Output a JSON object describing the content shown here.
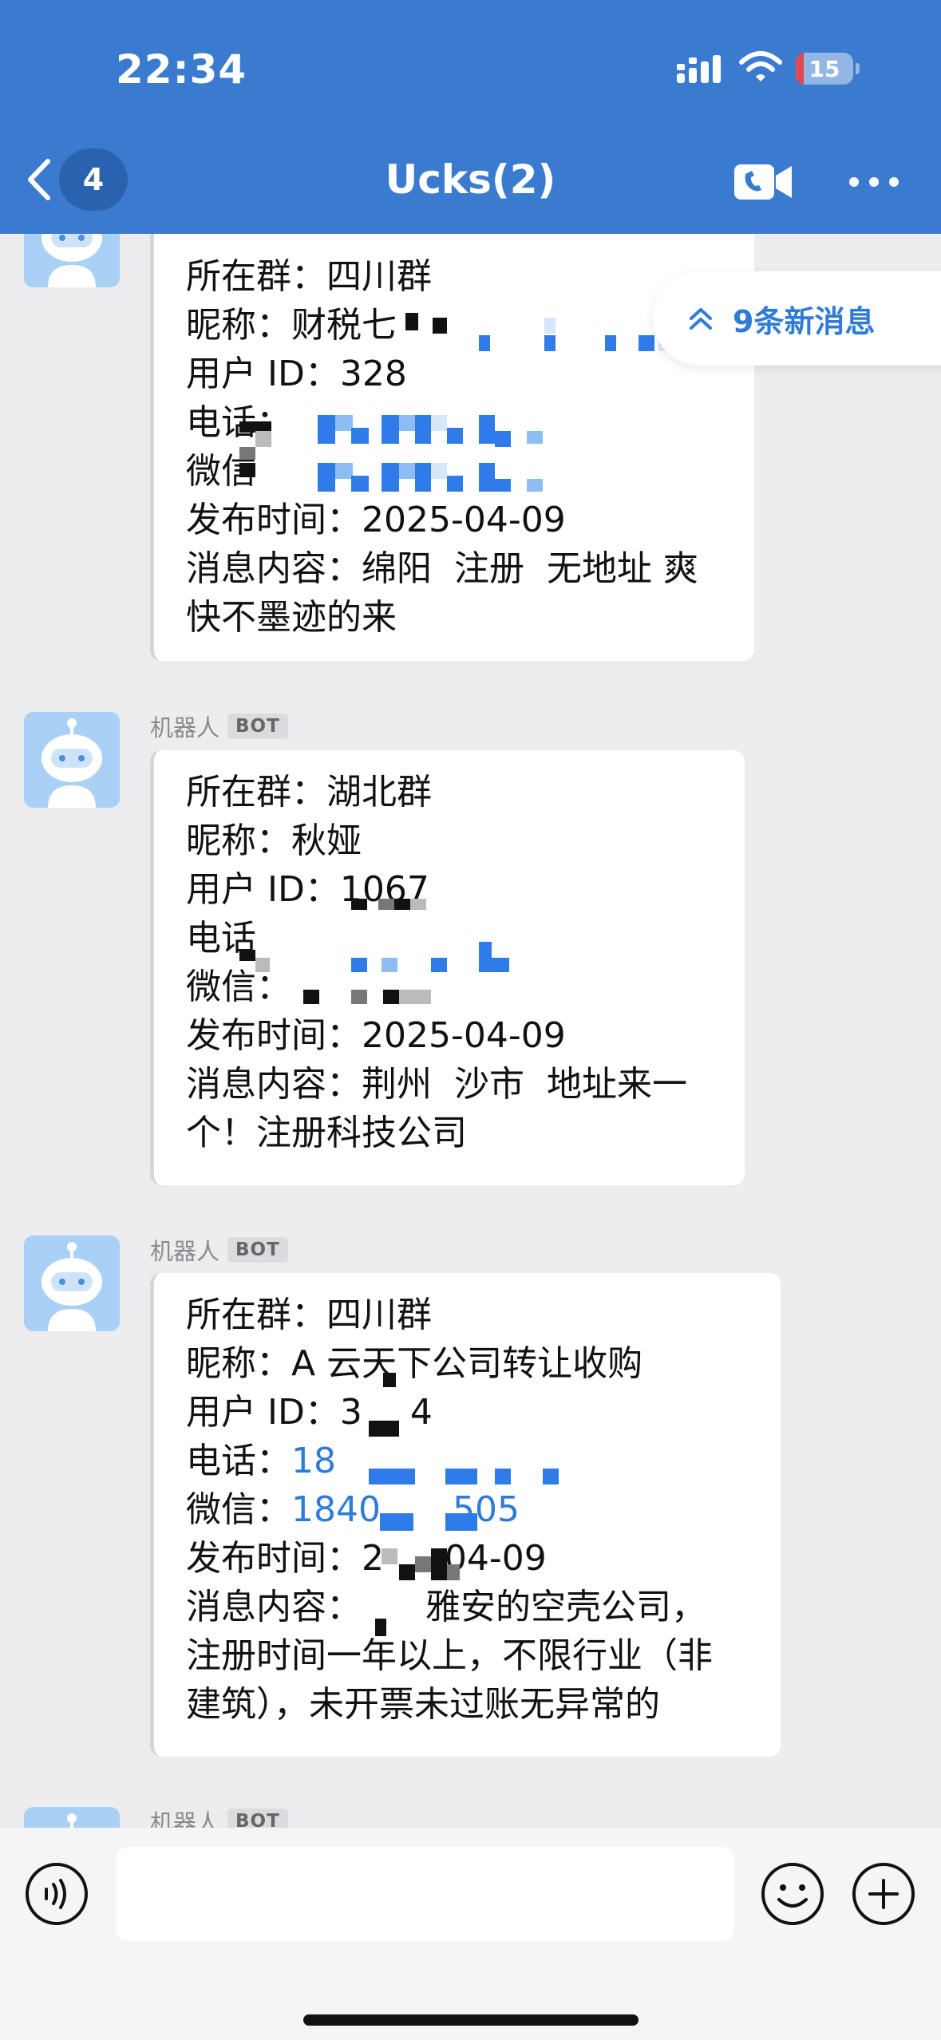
{
  "status_bar": {
    "time": "22:34",
    "battery": "15"
  },
  "nav": {
    "unread_count": "4",
    "title": "Ucks(2)"
  },
  "new_messages": {
    "label": "9条新消息"
  },
  "messages": [
    {
      "sender": "",
      "lines": [
        "所在群：四川群",
        "昵称：财税七",
        "用户 ID：328",
        "电话：",
        "微信",
        "发布时间：2025-04-09",
        "消息内容：绵阳  注册  无地址 爽",
        "快不墨迹的来"
      ]
    },
    {
      "sender": "机器人",
      "tag": "BOT",
      "lines": [
        "所在群：湖北群",
        "昵称：秋娅",
        "用户 ID：1067",
        "电话",
        "微信：",
        "发布时间：2025-04-09",
        "消息内容：荆州  沙市  地址来一",
        "个！注册科技公司"
      ]
    },
    {
      "sender": "机器人",
      "tag": "BOT",
      "lines": [
        "所在群：四川群",
        "昵称：A 云天下公司转让收购",
        "用户 ID：3",
        "电话：",
        "微信：",
        "发布时间：2",
        "消息内容：",
        "注册时间一年以上，不限行业（非",
        "建筑），未开票未过账无异常的"
      ],
      "phone": "18",
      "wechat": "1840",
      "wechat_tail": "505",
      "id_tail": "4",
      "date_tail": "-04-09",
      "content_tail": "雅安的空壳公司，"
    },
    {
      "sender": "机器人",
      "tag": "BOT"
    }
  ],
  "input": {
    "placeholder": ""
  },
  "colors": {
    "header": "#3a7bd0",
    "accent": "#2f7bd9",
    "badge": "#2b62b0"
  }
}
